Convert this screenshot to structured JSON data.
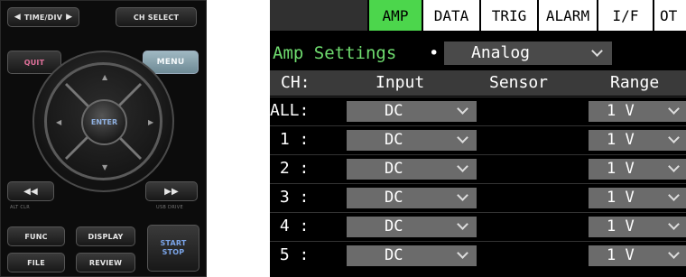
{
  "keypad": {
    "time_div": "TIME/DIV",
    "ch_select": "CH SELECT",
    "quit": "QUIT",
    "menu": "MENU",
    "enter": "ENTER",
    "alt_clr": "ALT CLR",
    "usb_drive": "USB DRIVE",
    "func": "FUNC",
    "display": "DISPLAY",
    "file": "FILE",
    "review": "REVIEW",
    "start": "START",
    "stop": "STOP"
  },
  "screen": {
    "tabs": [
      "",
      "AMP",
      "DATA",
      "TRIG",
      "ALARM",
      "I/F",
      "OT"
    ],
    "active_tab": "AMP",
    "amp_settings_label": "Amp Settings",
    "amp_mode_value": "Analog",
    "headers": {
      "ch": "CH:",
      "input": "Input",
      "sensor": "Sensor",
      "range": "Range"
    },
    "rows": [
      {
        "ch": "ALL:",
        "input": "DC",
        "range": "1 V"
      },
      {
        "ch": " 1 :",
        "input": "DC",
        "range": "1 V"
      },
      {
        "ch": " 2 :",
        "input": "DC",
        "range": "1 V"
      },
      {
        "ch": " 3 :",
        "input": "DC",
        "range": "1 V"
      },
      {
        "ch": " 4 :",
        "input": "DC",
        "range": "1 V"
      },
      {
        "ch": " 5 :",
        "input": "DC",
        "range": "1 V"
      }
    ],
    "colors": {
      "active_tab": "#4cd64c",
      "amp_label": "#6fdc6f",
      "cell_bg": "#6b6b6b"
    }
  }
}
